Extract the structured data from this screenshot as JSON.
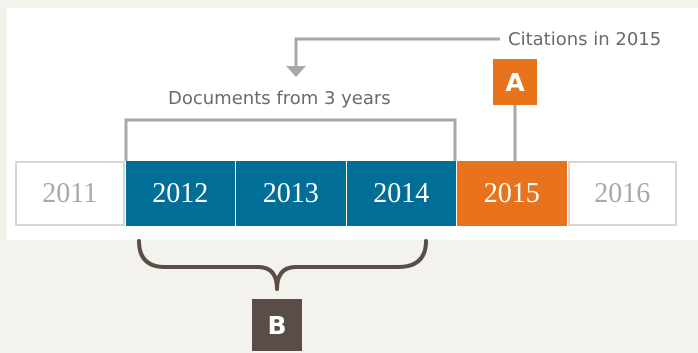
{
  "captions": {
    "citations": "Citations in 2015",
    "documents": "Documents from 3 years"
  },
  "badges": {
    "a": "A",
    "b": "B"
  },
  "years": [
    {
      "label": "2011",
      "style": "plain"
    },
    {
      "label": "2012",
      "style": "blue"
    },
    {
      "label": "2013",
      "style": "blue"
    },
    {
      "label": "2014",
      "style": "blue"
    },
    {
      "label": "2015",
      "style": "orange"
    },
    {
      "label": "2016",
      "style": "plain"
    }
  ],
  "colors": {
    "background": "#f4f2ec",
    "blue": "#006e96",
    "orange": "#e8731c",
    "dark_badge": "#5a4d48",
    "connector": "#a8a8a8",
    "brace": "#5a4d48"
  }
}
